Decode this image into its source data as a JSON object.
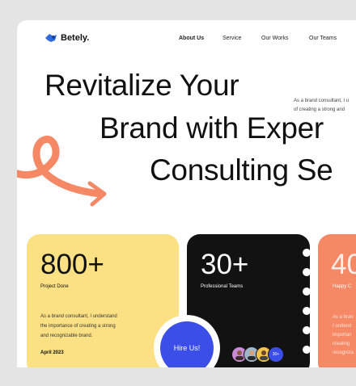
{
  "brand": {
    "name": "Betely.",
    "logo_color": "#2f6bdc"
  },
  "nav": {
    "items": [
      "About Us",
      "Service",
      "Our Works",
      "Our Teams"
    ],
    "active": "About Us"
  },
  "hero": {
    "line1": "Revitalize Your",
    "line2": "Brand with Exper",
    "line3": "Consulting Se",
    "description_l1": "As a brand consultant, I u",
    "description_l2": "of creating a strong and",
    "accent_color": "#f58966"
  },
  "cards": [
    {
      "number": "800+",
      "label": "Project Done",
      "desc_l1": "As a brand consultant, I understand",
      "desc_l2": "the importance of creating a strong",
      "desc_l3": "and recognizable brand.",
      "date": "April 2023",
      "color": "#fbe084"
    },
    {
      "number": "30+",
      "label": "Professional Teams",
      "color": "#121212",
      "avatar_count": "30+"
    },
    {
      "number": "40",
      "label": "Happy C",
      "desc_l1": "As a bran",
      "desc_l2": "I underst",
      "desc_l3": "importan",
      "desc_l4": "creating",
      "desc_l5": "recogniza",
      "color": "#f58966"
    }
  ],
  "hire_button": {
    "label": "Hire Us!",
    "color": "#3b4ee8"
  }
}
